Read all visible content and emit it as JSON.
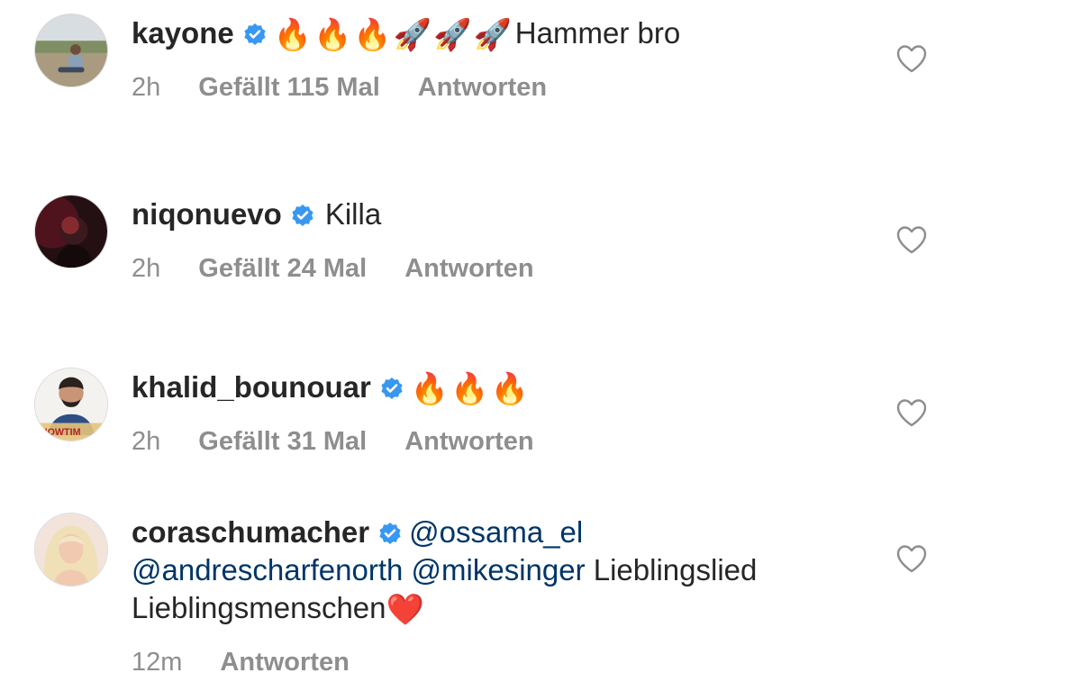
{
  "comments": [
    {
      "username": "kayone",
      "verified": true,
      "emojis": [
        "🔥",
        "🔥",
        "🔥",
        "🚀",
        "🚀",
        "🚀"
      ],
      "text": "Hammer bro",
      "time": "2h",
      "likes": "Gefällt 115 Mal",
      "reply": "Antworten"
    },
    {
      "username": "niqonuevo",
      "verified": true,
      "text": "Killa",
      "time": "2h",
      "likes": "Gefällt 24 Mal",
      "reply": "Antworten"
    },
    {
      "username": "khalid_bounouar",
      "verified": true,
      "emojis": [
        "🔥",
        "🔥",
        "🔥"
      ],
      "avatar_text": "HOWTIM",
      "time": "2h",
      "likes": "Gefällt 31 Mal",
      "reply": "Antworten"
    },
    {
      "username": "coraschumacher",
      "verified": true,
      "mention1": "@ossama_el",
      "mention2": "@andrescharfenorth",
      "mention3": "@mikesinger",
      "text_a": "Lieblingslied",
      "text_b": "Lieblingsmenschen",
      "heart_emoji": "❤️",
      "time": "12m",
      "reply": "Antworten"
    }
  ],
  "colors": {
    "text": "#262626",
    "meta": "#8e8e8e",
    "mention": "#003569",
    "verified": "#3897f0"
  },
  "icons": {
    "verified": "verified-badge-icon",
    "like": "heart-outline-icon"
  }
}
